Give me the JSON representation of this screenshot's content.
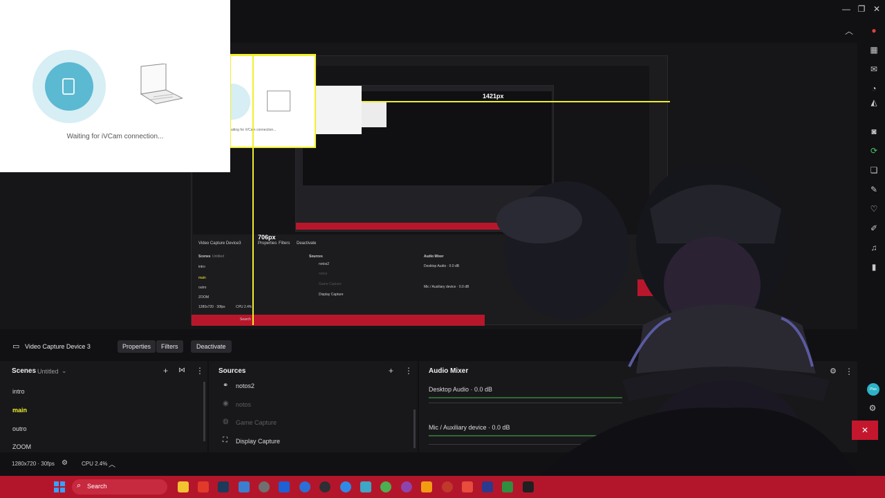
{
  "ivcam": {
    "message": "Waiting for iVCam connection..."
  },
  "nested_preview": {
    "width_label": "1421px",
    "height_label": "706px",
    "nested_message": "aiting for iVCam connection...",
    "source_name": "Video Capture Device3",
    "properties": "Properties",
    "filters": "Filters",
    "deactivate": "Deactivate",
    "scenes_title": "Scenes",
    "scenes_collection": "Untitled",
    "scene_items": [
      "intro",
      "main",
      "outro",
      "ZOOM"
    ],
    "sources_title": "Sources",
    "source_items": [
      "notos2",
      "notos",
      "Game Capture",
      "Display Capture"
    ],
    "mixer_title": "Audio Mixer",
    "desktop_audio": "Desktop Audio · 0.0 dB",
    "mic_audio": "Mic / Auxiliary device · 0.0 dB",
    "status": "1280x720 · 30fps",
    "cpu": "CPU 2.4%",
    "search": "Search"
  },
  "context_bar": {
    "source_name": "Video Capture Device 3",
    "properties": "Properties",
    "filters": "Filters",
    "deactivate": "Deactivate"
  },
  "scenes": {
    "title": "Scenes",
    "collection": "Untitled",
    "items": [
      "intro",
      "main",
      "outro",
      "ZOOM"
    ],
    "active": "main"
  },
  "sources": {
    "title": "Sources",
    "items": [
      {
        "label": "notos2",
        "icon": "link-icon",
        "visible": true
      },
      {
        "label": "notos",
        "icon": "eye-icon",
        "visible": false
      },
      {
        "label": "Game Capture",
        "icon": "gamepad-icon",
        "visible": false
      },
      {
        "label": "Display Capture",
        "icon": "monitor-icon",
        "visible": true
      }
    ]
  },
  "audio_mixer": {
    "title": "Audio Mixer",
    "channels": [
      {
        "label": "Desktop Audio · 0.0 dB"
      },
      {
        "label": "Mic / Auxiliary device · 0.0 dB"
      }
    ]
  },
  "status_bar": {
    "resolution": "1280x720 · 30fps",
    "cpu": "CPU 2.4%"
  },
  "taskbar": {
    "search_placeholder": "Search"
  },
  "plus_badge": "Plus",
  "colors": {
    "accent_yellow": "#f0f02a",
    "taskbar_red": "#b3162b",
    "ivcam_blue": "#5bb9d2",
    "meter_green": "#2f6a35"
  }
}
